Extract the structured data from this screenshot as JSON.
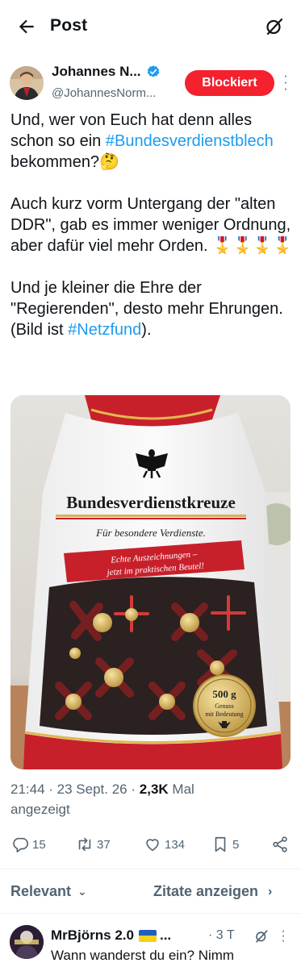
{
  "header": {
    "title": "Post",
    "back_icon": "arrow-left-icon",
    "grok_icon": "grok-icon"
  },
  "author": {
    "name": "Johannes N...",
    "handle": "@JohannesNorm...",
    "verified": true,
    "blocked_label": "Blockiert"
  },
  "post": {
    "p1_a": "Und, wer von Euch hat denn alles schon so ein ",
    "p1_tag": "#Bundesverdienstblech",
    "p1_b": " bekommen?🤔",
    "p2": "Auch kurz vorm Untergang der \"alten DDR\", gab es immer weniger Ordnung, aber dafür viel mehr Orden. 🎖️🎖️🎖️🎖️",
    "p3_a": "Und je kleiner die Ehre der \"Regierenden\", desto mehr Ehrungen. (Bild ist ",
    "p3_tag": "#Netzfund",
    "p3_b": ")."
  },
  "image": {
    "brand": "Bundesverdienstkreuze",
    "tagline": "Für besondere Verdienste.",
    "ribbon": "Echte Auszeichnungen – jetzt im praktischen Beutel!",
    "ribbon_line1": "Echte Auszeichnungen –",
    "ribbon_line2": "jetzt im praktischen Beutel!",
    "seal_weight": "500 g",
    "seal_line1": "Genuss",
    "seal_line2": "mit Bedeutung"
  },
  "meta": {
    "time": "21:44",
    "date": "23 Sept. 26",
    "views": "2,3K",
    "views_label_a": "Mal",
    "views_label_b": "angezeigt"
  },
  "actions": {
    "replies": "15",
    "reposts": "37",
    "likes": "134",
    "bookmarks": "5"
  },
  "sort": {
    "left_label": "Relevant",
    "right_label": "Zitate anzeigen"
  },
  "reply": {
    "name": "MrBjörns 2.0",
    "name_suffix": "...",
    "time": "· 3 T",
    "text": "Wann wanderst du ein? Nimm"
  },
  "colors": {
    "accent": "#1d9bf0",
    "blocked": "#f4212e",
    "muted": "#536471",
    "text": "#0f1419"
  }
}
